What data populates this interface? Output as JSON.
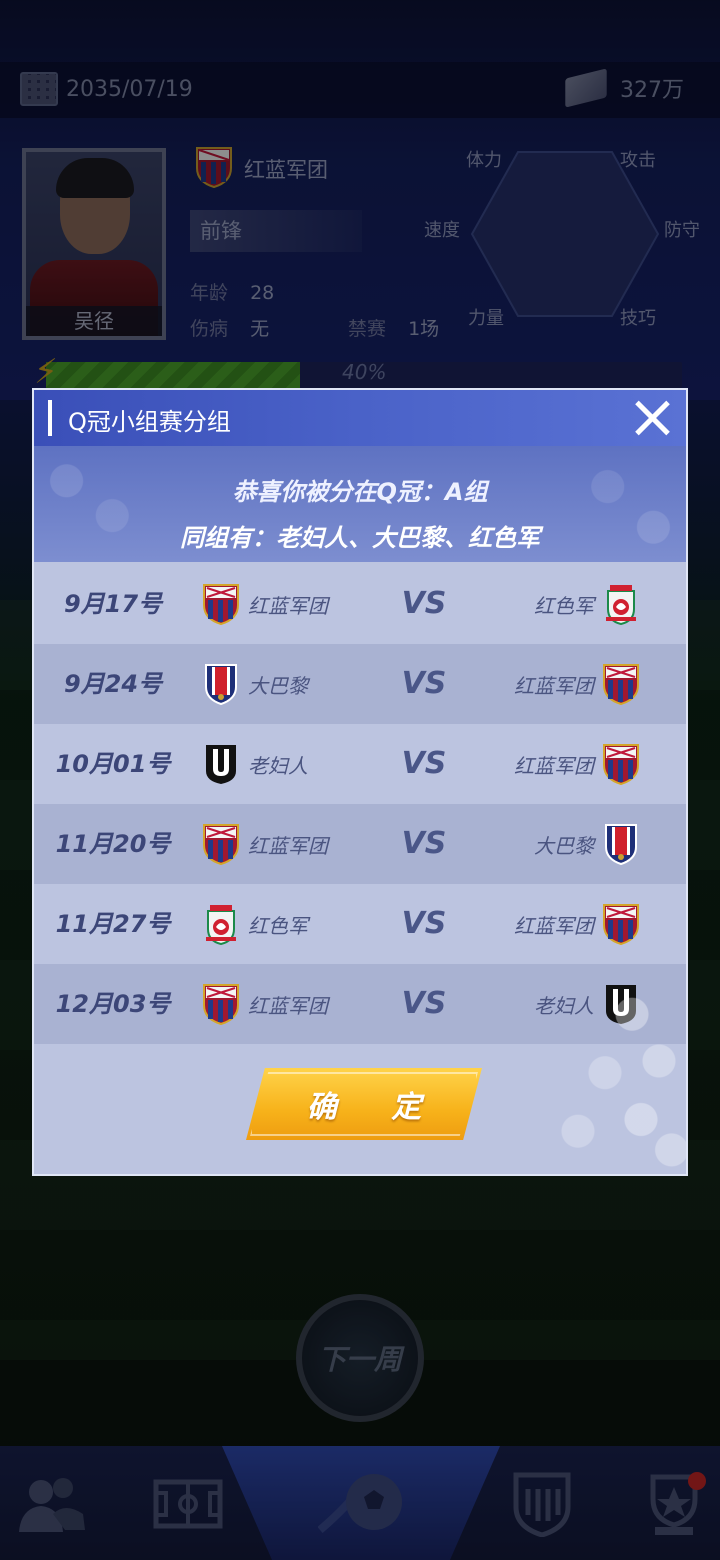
{
  "topbar": {
    "date": "2035/07/19",
    "money": "327万"
  },
  "player": {
    "name": "吴径",
    "club": "红蓝军团",
    "position": "前锋",
    "age_label": "年龄",
    "age": "28",
    "injury_label": "伤病",
    "injury": "无",
    "ban_label": "禁赛",
    "ban": "1场",
    "energy_percent": "40%"
  },
  "radar": {
    "stamina": "体力",
    "attack": "攻击",
    "speed": "速度",
    "defense": "防守",
    "power": "力量",
    "skill": "技巧"
  },
  "dialog": {
    "title": "Q冠小组赛分组",
    "line1": "恭喜你被分在Q冠：A组",
    "line2": "同组有：老妇人、大巴黎、红色军",
    "vs": "VS",
    "confirm": "确 定",
    "matches": [
      {
        "date": "9月17号",
        "home": "红蓝军团",
        "away": "红色军",
        "home_badge": "barca",
        "away_badge": "liverpool"
      },
      {
        "date": "9月24号",
        "home": "大巴黎",
        "away": "红蓝军团",
        "home_badge": "psg",
        "away_badge": "barca"
      },
      {
        "date": "10月01号",
        "home": "老妇人",
        "away": "红蓝军团",
        "home_badge": "juve",
        "away_badge": "barca"
      },
      {
        "date": "11月20号",
        "home": "红蓝军团",
        "away": "大巴黎",
        "home_badge": "barca",
        "away_badge": "psg"
      },
      {
        "date": "11月27号",
        "home": "红色军",
        "away": "红蓝军团",
        "home_badge": "liverpool",
        "away_badge": "barca"
      },
      {
        "date": "12月03号",
        "home": "红蓝军团",
        "away": "老妇人",
        "home_badge": "barca",
        "away_badge": "juve"
      }
    ]
  },
  "next_week": "下一周",
  "nav": {
    "items": [
      "team-icon",
      "pitch-icon",
      "match-icon",
      "club-icon",
      "trophy-icon"
    ]
  },
  "colors": {
    "header_blue": "#3a4fb8",
    "confirm_yellow": "#f7b21a",
    "energy_green": "#4aa32c"
  }
}
